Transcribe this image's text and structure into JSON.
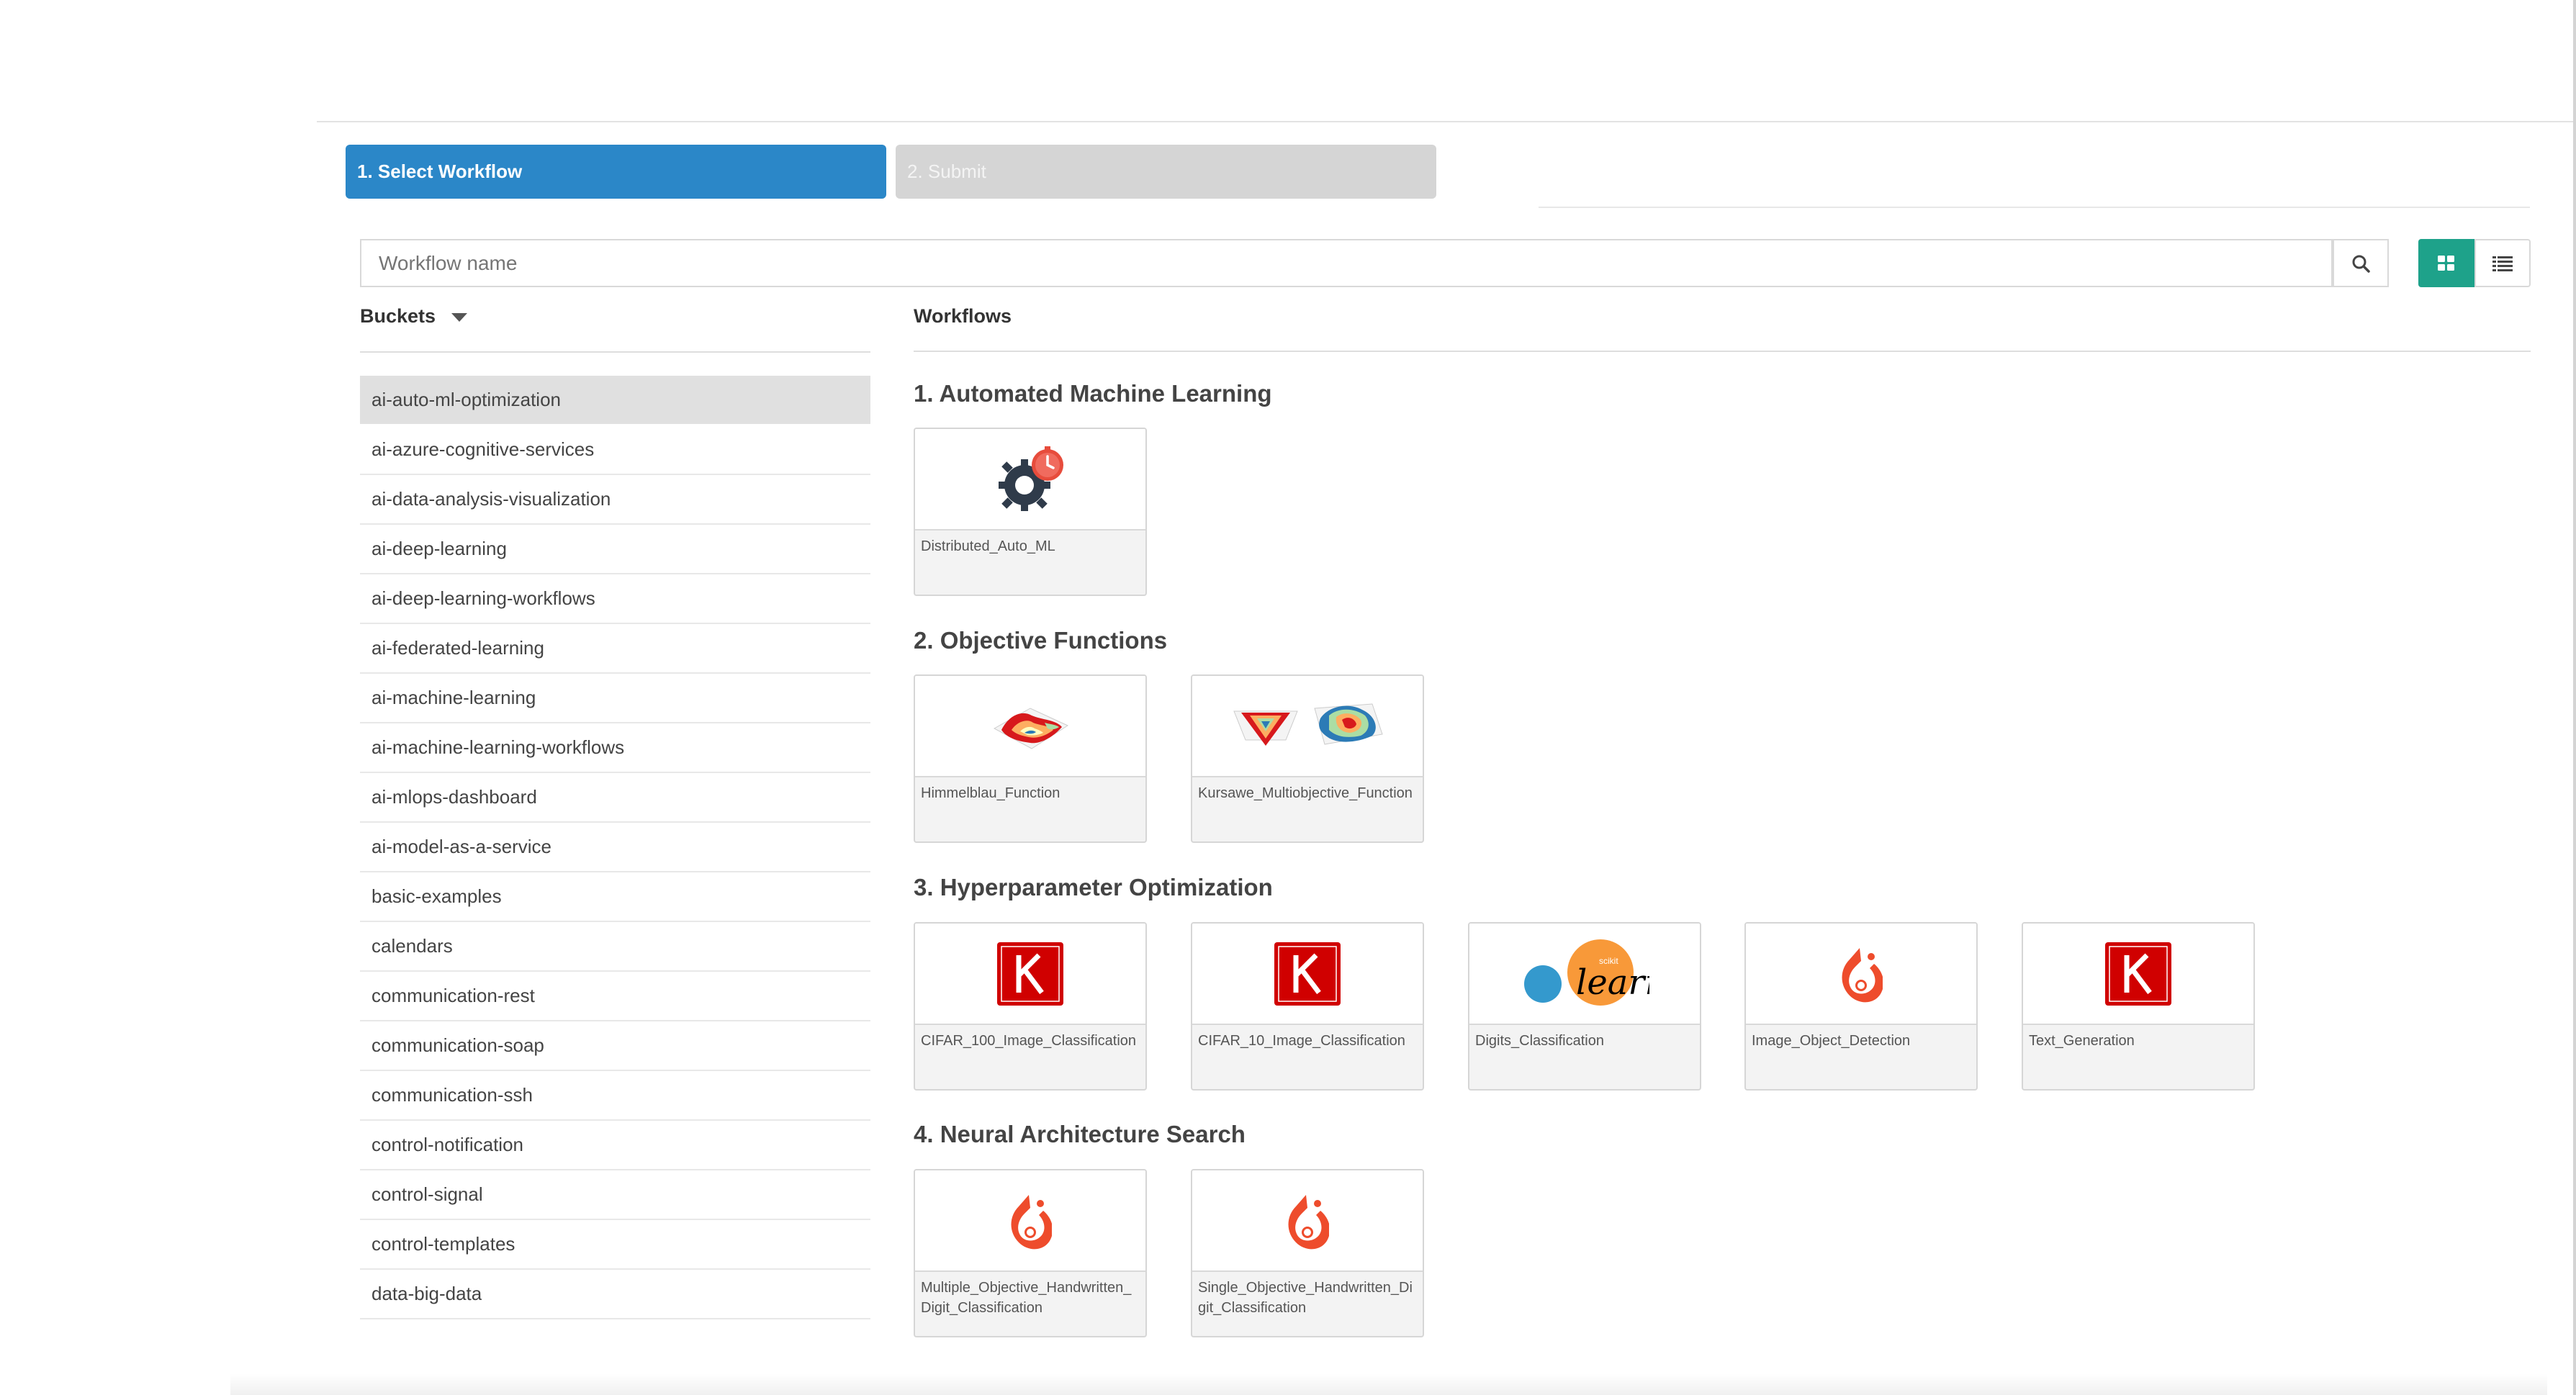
{
  "wizard": {
    "step1_label": "1. Select Workflow",
    "step2_label": "2. Submit"
  },
  "search": {
    "placeholder": "Workflow name"
  },
  "buckets": {
    "heading": "Buckets",
    "items": [
      "ai-auto-ml-optimization",
      "ai-azure-cognitive-services",
      "ai-data-analysis-visualization",
      "ai-deep-learning",
      "ai-deep-learning-workflows",
      "ai-federated-learning",
      "ai-machine-learning",
      "ai-machine-learning-workflows",
      "ai-mlops-dashboard",
      "ai-model-as-a-service",
      "basic-examples",
      "calendars",
      "communication-rest",
      "communication-soap",
      "communication-ssh",
      "control-notification",
      "control-signal",
      "control-templates",
      "data-big-data"
    ],
    "selected_index": 0
  },
  "workflows": {
    "heading": "Workflows",
    "sections": [
      {
        "title": "1. Automated Machine Learning",
        "cards": [
          {
            "name": "Distributed_Auto_ML",
            "icon": "gear-clock-icon"
          }
        ]
      },
      {
        "title": "2. Objective Functions",
        "cards": [
          {
            "name": "Himmelblau_Function",
            "icon": "surface-plot-icon"
          },
          {
            "name": "Kursawe_Multiobjective_Function",
            "icon": "surface-plots-icon"
          }
        ]
      },
      {
        "title": "3. Hyperparameter Optimization",
        "cards": [
          {
            "name": "CIFAR_100_Image_Classification",
            "icon": "keras-icon"
          },
          {
            "name": "CIFAR_10_Image_Classification",
            "icon": "keras-icon"
          },
          {
            "name": "Digits_Classification",
            "icon": "scikit-learn-icon"
          },
          {
            "name": "Image_Object_Detection",
            "icon": "pytorch-icon"
          },
          {
            "name": "Text_Generation",
            "icon": "keras-icon"
          }
        ]
      },
      {
        "title": "4. Neural Architecture Search",
        "cards": [
          {
            "name": "Multiple_Objective_Handwritten_Digit_Classification",
            "icon": "pytorch-icon"
          },
          {
            "name": "Single_Objective_Handwritten_Digit_Classification",
            "icon": "pytorch-icon"
          }
        ]
      }
    ]
  },
  "colors": {
    "primary": "#2b87c8",
    "grid_toggle": "#1ea28a",
    "keras": "#d00000",
    "pytorch": "#ee4c2c"
  }
}
